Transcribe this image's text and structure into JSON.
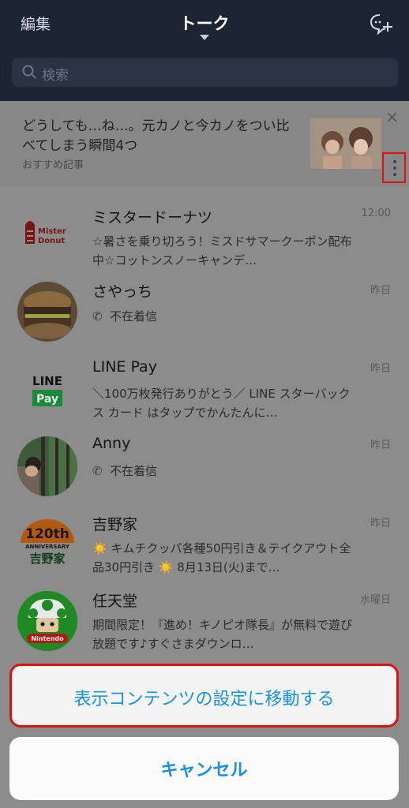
{
  "header": {
    "edit_label": "編集",
    "title": "トーク",
    "new_chat_icon": "chat-plus-icon"
  },
  "search": {
    "placeholder": "検索",
    "icon": "search-icon"
  },
  "banner": {
    "title": "どうしても…ね…。元カノと今カノをつい比べてしまう瞬間4つ",
    "subtitle": "おすすめ記事",
    "close_icon": "close-icon",
    "more_icon": "vertical-dots-icon"
  },
  "chats": [
    {
      "name": "ミスタードーナツ",
      "time": "12:00",
      "message": "☆暑さを乗り切ろう！ミスドサマークーポン配布中☆コットンスノーキャンデ…"
    },
    {
      "name": "さやっち",
      "time": "昨日",
      "message": "不在着信",
      "call": true
    },
    {
      "name": "LINE Pay",
      "time": "昨日",
      "message": "＼100万枚発行ありがとう／ LINE スターバックス カード はタップでかんたんに…"
    },
    {
      "name": "Anny",
      "time": "昨日",
      "message": "不在着信",
      "call": true
    },
    {
      "name": "吉野家",
      "time": "昨日",
      "message": "☀️ キムチクッパ各種50円引き＆テイクアウト全品30円引き ☀️ 8月13日(火)まで…"
    },
    {
      "name": "任天堂",
      "time": "水曜日",
      "message": "期間限定！『進め！キノピオ隊長』が無料で遊び放題です♪すぐさまダウンロ…"
    }
  ],
  "logos": {
    "misterdonut": "Mister Donut",
    "linepay_top": "LINE",
    "linepay_bottom": "Pay",
    "yoshinoya_num": "120th",
    "yoshinoya_anniv": "ANNIVERSARY",
    "yoshinoya_name": "吉野家",
    "nintendo": "Nintendo"
  },
  "sheet": {
    "action_label": "表示コンテンツの設定に移動する",
    "cancel_label": "キャンセル"
  },
  "colors": {
    "header_bg": "#1d2433",
    "accent_blue": "#1a8fe0",
    "highlight_red": "#dd1111"
  }
}
